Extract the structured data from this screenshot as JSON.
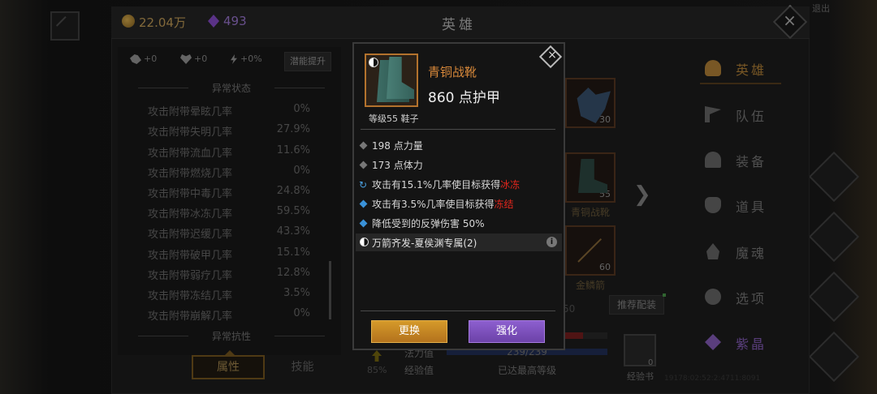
{
  "header": {
    "gold": "22.04万",
    "gems": "493",
    "title": "英雄"
  },
  "top_right_text": "退出",
  "left_panel": {
    "chips": [
      "+0",
      "+0",
      "+0%"
    ],
    "potential_button": "潜能提升",
    "section_status": "异常状态",
    "section_resist": "异常抗性",
    "stats": [
      {
        "label": "攻击附带晕眩几率",
        "value": "0%"
      },
      {
        "label": "攻击附带失明几率",
        "value": "27.9%"
      },
      {
        "label": "攻击附带流血几率",
        "value": "11.6%"
      },
      {
        "label": "攻击附带燃烧几率",
        "value": "0%"
      },
      {
        "label": "攻击附带中毒几率",
        "value": "24.8%"
      },
      {
        "label": "攻击附带冰冻几率",
        "value": "59.5%"
      },
      {
        "label": "攻击附带迟缓几率",
        "value": "43.3%"
      },
      {
        "label": "攻击附带破甲几率",
        "value": "15.1%"
      },
      {
        "label": "攻击附带弱疗几率",
        "value": "12.8%"
      },
      {
        "label": "攻击附带冻结几率",
        "value": "3.5%"
      },
      {
        "label": "攻击附带崩解几率",
        "value": "0%"
      }
    ],
    "tabs": {
      "attributes": "属性",
      "skills": "技能"
    }
  },
  "hero_area": {
    "slot_wolf_level": "30",
    "slot_boot_level": "55",
    "slot_boot_name": "青铜战靴",
    "slot_spear_level": "60",
    "slot_spear_name": "金鳞箭",
    "partial_num": "50",
    "recommend_button": "推荐配装",
    "hp_percent": "85%",
    "mana_label": "法力值",
    "mana_value": "239/239",
    "exp_label": "经验值",
    "exp_value": "已达最高等级",
    "book_label": "经验书",
    "book_count": "0",
    "coords": "19178:02:52:2:4711:8091"
  },
  "nav": {
    "items": [
      {
        "label": "英雄",
        "icon": "person-icon"
      },
      {
        "label": "队伍",
        "icon": "flag-icon"
      },
      {
        "label": "装备",
        "icon": "helmet-icon"
      },
      {
        "label": "道具",
        "icon": "bag-icon"
      },
      {
        "label": "魔魂",
        "icon": "flame-icon"
      },
      {
        "label": "选项",
        "icon": "gear-icon"
      },
      {
        "label": "紫晶",
        "icon": "crystal-icon"
      }
    ]
  },
  "item_popup": {
    "name": "青铜战靴",
    "armor": "860 点护甲",
    "level_type": "等级55 鞋子",
    "attributes": [
      "198 点力量",
      "173 点体力"
    ],
    "effect_freeze_pre": "攻击有15.1%几率使目标获得",
    "effect_freeze_word": "冰冻",
    "effect_frozen_pre": "攻击有3.5%几率使目标获得",
    "effect_frozen_word": "冻结",
    "effect_reflect": "降低受到的反弹伤害 50%",
    "set_name": "万箭齐发-夏侯渊专属(2)",
    "btn_replace": "更换",
    "btn_enhance": "强化"
  },
  "colors": {
    "rarity_orange": "#d7883a",
    "effect_red": "#e2261c",
    "replace_gold": "#d59a2a",
    "enhance_purple": "#8d5fcf",
    "nav_active": "#b8863a"
  }
}
